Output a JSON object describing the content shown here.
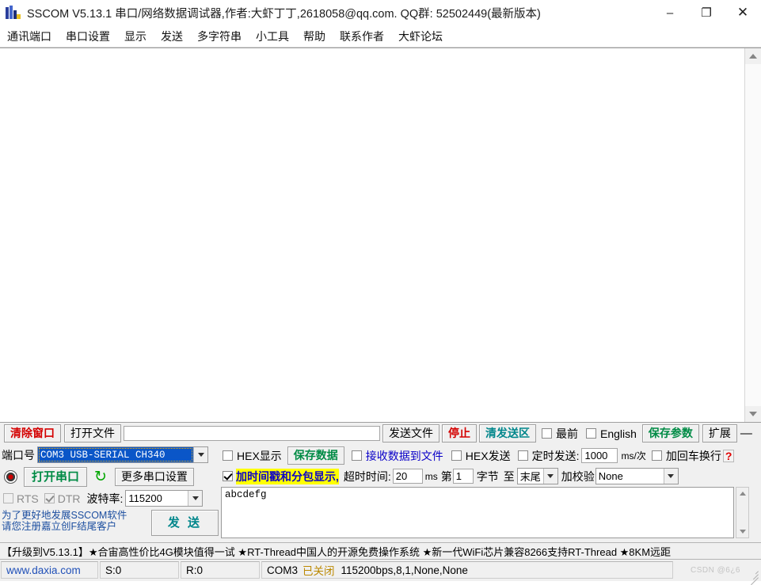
{
  "window": {
    "title": "SSCOM V5.13.1 串口/网络数据调试器,作者:大虾丁丁,2618058@qq.com. QQ群: 52502449(最新版本)",
    "icon": "sscom-app-icon",
    "minimize": "–",
    "maximize": "❐",
    "close": "✕"
  },
  "menubar": {
    "items": [
      {
        "label": "通讯端口"
      },
      {
        "label": "串口设置"
      },
      {
        "label": "显示"
      },
      {
        "label": "发送"
      },
      {
        "label": "多字符串"
      },
      {
        "label": "小工具"
      },
      {
        "label": "帮助"
      },
      {
        "label": "联系作者"
      },
      {
        "label": "大虾论坛"
      }
    ]
  },
  "receive": {
    "text": "",
    "scroll_up_icon": "triangle-up-icon",
    "scroll_down_icon": "triangle-down-icon"
  },
  "toolbar": {
    "clear_window": "清除窗口",
    "open_file": "打开文件",
    "file_path_value": "",
    "file_path_placeholder": "",
    "send_file": "发送文件",
    "stop": "停止",
    "clear_send": "清发送区",
    "topmost_label": "最前",
    "topmost_checked": false,
    "english_label": "English",
    "english_checked": false,
    "save_params": "保存参数",
    "extend": "扩展",
    "extend_dash": "—"
  },
  "port": {
    "label": "端口号",
    "value": "COM3 USB-SERIAL CH340",
    "dropdown_icon": "chevron-down-icon",
    "open_button": "打开串口",
    "led": "status-led",
    "refresh_icon": "refresh-icon",
    "more_settings": "更多串口设置",
    "rts_label": "RTS",
    "rts_checked": false,
    "dtr_label": "DTR",
    "dtr_checked": true,
    "baud_label": "波特率:",
    "baud_value": "115200",
    "promo_line1": "为了更好地发展SSCOM软件",
    "promo_line2": "请您注册嘉立创F结尾客户",
    "send_button": "发 送"
  },
  "recvopts": {
    "hex_display_label": "HEX显示",
    "hex_display_checked": false,
    "save_data": "保存数据",
    "recv_to_file_label": "接收数据到文件",
    "recv_to_file_checked": false,
    "hex_send_label": "HEX发送",
    "hex_send_checked": false,
    "timed_send_label": "定时发送:",
    "timed_send_checked": false,
    "timed_send_value": "1000",
    "timed_send_unit": "ms/次",
    "crlf_label": "加回车换行",
    "crlf_checked": false,
    "help_icon": "help-question-icon",
    "timestamp_label": "加时间戳和分包显示,",
    "timestamp_checked": true,
    "timeout_label": "超时时间:",
    "timeout_value": "20",
    "timeout_unit": "ms",
    "byte_prefix": "第",
    "byte_index_value": "1",
    "byte_word": "字节",
    "byte_to": "至",
    "byte_end_value": "末尾",
    "checksum_label": "加校验",
    "checksum_value": "None"
  },
  "sendbox": {
    "text": "abcdefg"
  },
  "ad": {
    "text": "【升级到V5.13.1】★合宙高性价比4G模块值得一试 ★RT-Thread中国人的开源免费操作系统 ★新一代WiFi芯片兼容8266支持RT-Thread ★8KM远距"
  },
  "statusbar": {
    "site": "www.daxia.com",
    "sent": "S:0",
    "received": "R:0",
    "port_state_port": "COM3",
    "port_state_status": "已关闭",
    "port_state_params": "115200bps,8,1,None,None",
    "watermark": "CSDN @6¿6"
  }
}
